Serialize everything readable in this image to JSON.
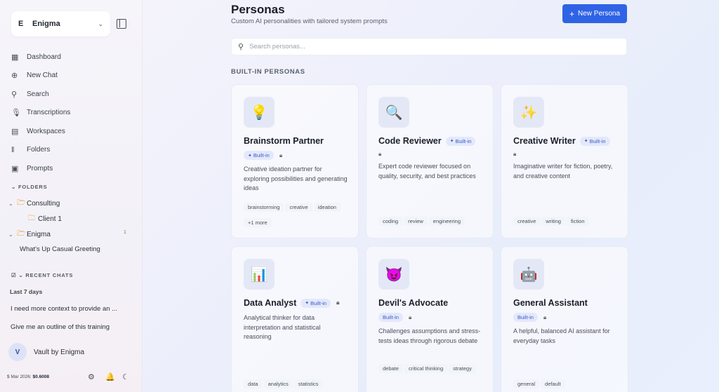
{
  "sidebar": {
    "workspace": {
      "letter": "E",
      "name": "Enigma"
    },
    "nav": [
      {
        "label": "Dashboard",
        "icon": "dashboard-icon",
        "glyph": "▦"
      },
      {
        "label": "New Chat",
        "icon": "plus-circle-icon",
        "glyph": "⊕"
      },
      {
        "label": "Search",
        "icon": "search-icon",
        "glyph": "⚲"
      },
      {
        "label": "Transcriptions",
        "icon": "microphone-icon",
        "glyph": "🎙"
      },
      {
        "label": "Workspaces",
        "icon": "building-icon",
        "glyph": "▤"
      },
      {
        "label": "Folders",
        "icon": "library-icon",
        "glyph": "‖"
      },
      {
        "label": "Prompts",
        "icon": "document-icon",
        "glyph": "▣"
      }
    ],
    "folders_label": "FOLDERS",
    "folders": [
      {
        "label": "Consulting"
      },
      {
        "label": "Client 1"
      },
      {
        "label": "Enigma",
        "count": "1"
      }
    ],
    "folder_chat": "What's Up Casual Greeting",
    "recent_label": "RECENT CHATS",
    "period_label": "Last 7 days",
    "recent_chats": [
      "I need more context to provide an ...",
      "Give me an outline of this training"
    ],
    "vault": {
      "initial": "V",
      "name": "Vault by Enigma"
    },
    "usage": {
      "period": "Mar 2026:",
      "amount": "$0.6008"
    }
  },
  "main": {
    "title": "Personas",
    "subtitle": "Custom AI personalities with tailored system prompts",
    "new_button": "New Persona",
    "search_placeholder": "Search personas...",
    "section_title": "BUILT-IN PERSONAS",
    "builtin_label": "Built-in",
    "personas": [
      {
        "name": "Brainstorm Partner",
        "emoji": "💡",
        "desc": "Creative ideation partner for exploring possibilities and generating ideas",
        "tags": [
          "brainstorming",
          "creative",
          "ideation",
          "+1 more"
        ]
      },
      {
        "name": "Code Reviewer",
        "emoji": "🔍",
        "desc": "Expert code reviewer focused on quality, security, and best practices",
        "tags": [
          "coding",
          "review",
          "engineering"
        ]
      },
      {
        "name": "Creative Writer",
        "emoji": "✨",
        "desc": "Imaginative writer for fiction, poetry, and creative content",
        "tags": [
          "creative",
          "writing",
          "fiction"
        ]
      },
      {
        "name": "Data Analyst",
        "emoji": "📊",
        "desc": "Analytical thinker for data interpretation and statistical reasoning",
        "tags": [
          "data",
          "analytics",
          "statistics"
        ]
      },
      {
        "name": "Devil's Advocate",
        "emoji": "😈",
        "desc": "Challenges assumptions and stress-tests ideas through rigorous debate",
        "tags": [
          "debate",
          "critical thinking",
          "strategy"
        ]
      },
      {
        "name": "General Assistant",
        "emoji": "🤖",
        "desc": "A helpful, balanced AI assistant for everyday tasks",
        "tags": [
          "general",
          "default"
        ]
      }
    ]
  },
  "colors": {
    "accent": "#2f63e6",
    "badge_bg": "#e3e9fb",
    "badge_text": "#3b58c9",
    "folder": "#e2a23a"
  }
}
